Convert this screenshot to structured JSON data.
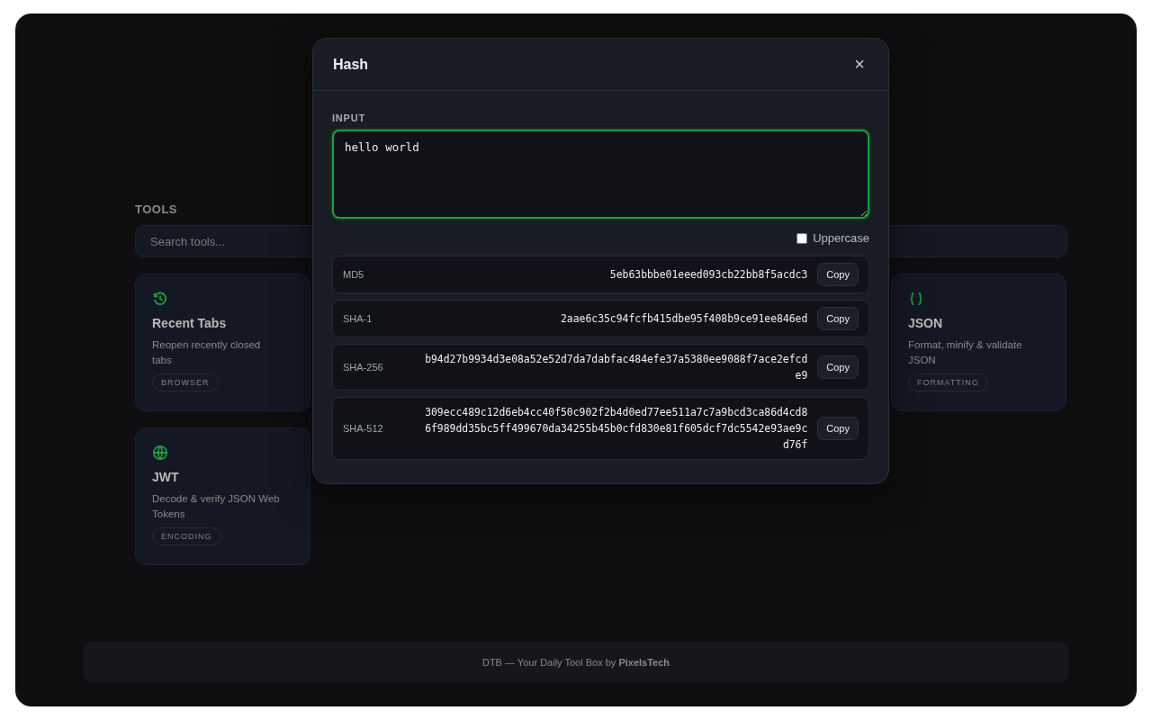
{
  "tools": {
    "heading": "TOOLS",
    "search": {
      "placeholder": "Search tools..."
    },
    "cards": [
      {
        "kind": "history",
        "title": "Recent Tabs",
        "description": "Reopen recently closed tabs",
        "tag": "BROWSER"
      },
      {
        "kind": "braces",
        "title": "JSON",
        "description": "Format, minify & validate JSON",
        "tag": "FORMATTING"
      },
      {
        "kind": "globe",
        "title": "JWT",
        "description": "Decode & verify JSON Web Tokens",
        "tag": "ENCODING"
      }
    ]
  },
  "footer": "DTB — Your Daily Tool Box by **PixelsTech**",
  "dialog": {
    "title": "Hash",
    "close": "×",
    "input_label": "INPUT",
    "input_value": "hello world",
    "uppercase": {
      "label": "Uppercase",
      "checked": false
    },
    "hashes": [
      {
        "algorithm": "MD5",
        "value": "5eb63bbbe01eeed093cb22bb8f5acdc3",
        "button": "Copy"
      },
      {
        "algorithm": "SHA-1",
        "value": "2aae6c35c94fcfb415dbe95f408b9ce91ee846ed",
        "button": "Copy"
      },
      {
        "algorithm": "SHA-256",
        "value": "b94d27b9934d3e08a52e52d7da7dabfac484efe37a5380ee9088f7ace2efcde9",
        "button": "Copy"
      },
      {
        "algorithm": "SHA-512",
        "value": "309ecc489c12d6eb4cc40f50c902f2b4d0ed77ee511a7c7a9bcd3ca86d4cd86f989dd35bc5ff499670da34255b45b0cfd830e81f605dcf7dc5542e93ae9cd76f",
        "button": "Copy"
      }
    ]
  }
}
